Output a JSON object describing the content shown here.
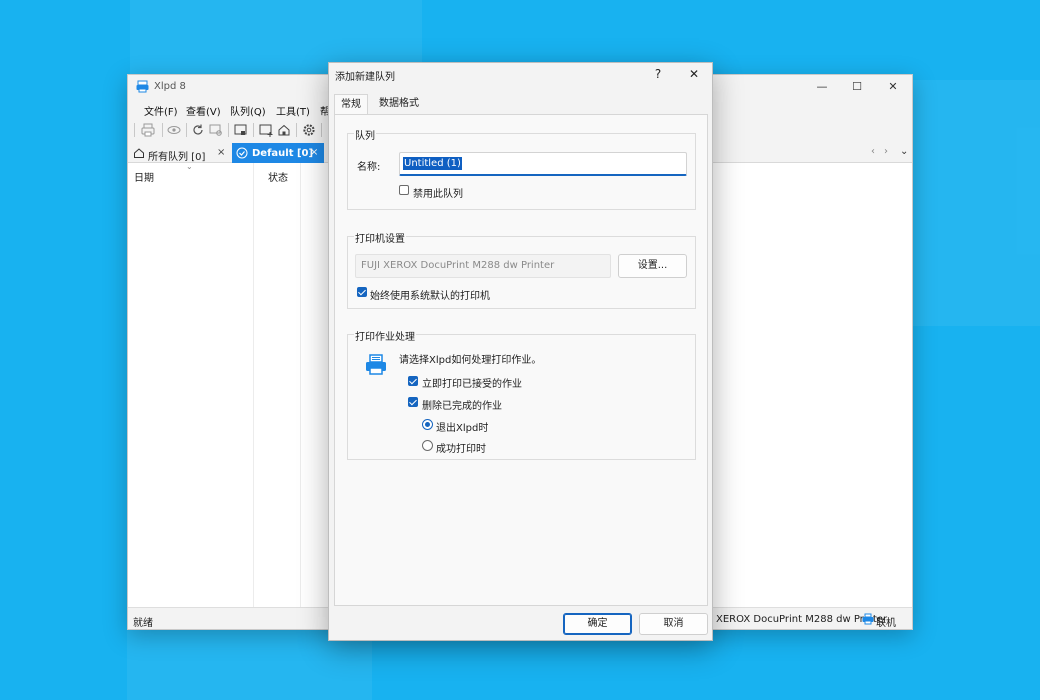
{
  "main_window": {
    "title": "Xlpd 8",
    "menu": [
      "文件(F)",
      "查看(V)",
      "队列(Q)",
      "工具(T)",
      "帮"
    ],
    "tabs": [
      {
        "label": "所有队列 [0]",
        "close": "×",
        "active": false
      },
      {
        "label": "Default [0]",
        "close": "×",
        "active": true
      }
    ],
    "columns": [
      "日期",
      "状态"
    ],
    "status_left": "就绪",
    "status_printer": "XEROX DocuPrint M288 dw Printer",
    "status_online": "联机",
    "controls": {
      "minimize": "—",
      "maximize": "☐",
      "close": "✕",
      "prev": "‹",
      "next": "›",
      "dropdown": "⌄"
    }
  },
  "dialog": {
    "title": "添加新建队列",
    "help": "?",
    "close": "✕",
    "tabs": [
      "常规",
      "数据格式"
    ],
    "queue_group": {
      "title": "队列",
      "name_label": "名称:",
      "name_value": "Untitled (1)",
      "disable_label": "禁用此队列",
      "disable_checked": false
    },
    "printer_group": {
      "title": "打印机设置",
      "printer_name": "FUJI XEROX DocuPrint M288 dw Printer",
      "settings_button": "设置...",
      "use_default_label": "始终使用系统默认的打印机",
      "use_default_checked": true
    },
    "job_group": {
      "title": "打印作业处理",
      "prompt": "请选择Xlpd如何处理打印作业。",
      "print_immediately": "立即打印已接受的作业",
      "print_immediately_checked": true,
      "delete_completed": "删除已完成的作业",
      "delete_completed_checked": true,
      "radio_on_exit": "退出Xlpd时",
      "radio_on_exit_selected": true,
      "radio_on_success": "成功打印时",
      "radio_on_success_selected": false
    },
    "ok": "确定",
    "cancel": "取消"
  },
  "colors": {
    "background": "#18b2f0",
    "accent": "#1565c0",
    "active_tab": "#1e88e5"
  }
}
